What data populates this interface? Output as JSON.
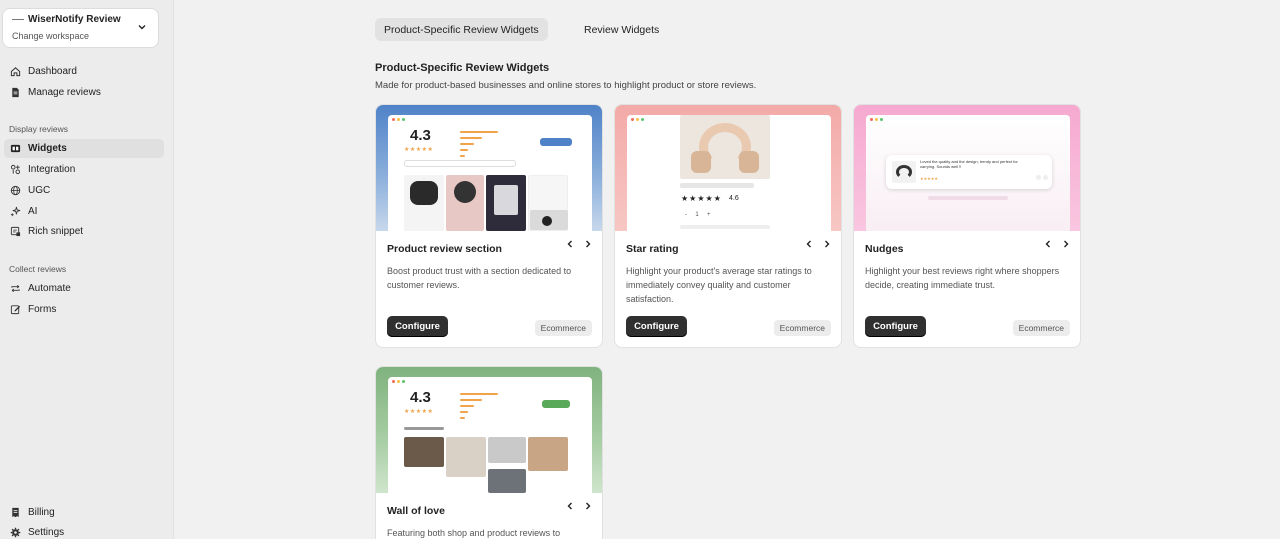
{
  "workspace": {
    "name": "WiserNotify Review",
    "sub": "Change workspace"
  },
  "nav": {
    "dashboard": "Dashboard",
    "manage_reviews": "Manage reviews",
    "display_group": "Display reviews",
    "widgets": "Widgets",
    "integration": "Integration",
    "ugc": "UGC",
    "ai": "AI",
    "rich_snippet": "Rich snippet",
    "collect_group": "Collect reviews",
    "automate": "Automate",
    "forms": "Forms",
    "billing": "Billing",
    "settings": "Settings"
  },
  "tabs": [
    "Product-Specific Review Widgets",
    "Review Widgets"
  ],
  "section": {
    "title": "Product-Specific Review Widgets",
    "desc": "Made for product-based businesses and online stores to highlight product or store reviews."
  },
  "cards": [
    {
      "title": "Product review section",
      "desc": "Boost product trust with a section dedicated to customer reviews.",
      "button": "Configure",
      "tag": "Ecommerce",
      "rating": "4.3"
    },
    {
      "title": "Star rating",
      "desc": "Highlight your product's average star ratings to immediately convey quality and customer satisfaction.",
      "button": "Configure",
      "tag": "Ecommerce",
      "rating": "4.6"
    },
    {
      "title": "Nudges",
      "desc": "Highlight your best reviews right where shoppers decide, creating immediate trust.",
      "button": "Configure",
      "tag": "Ecommerce",
      "quote": "Loved the quality and the design, trendy and perfect for carrying. Sounds well !!"
    },
    {
      "title": "Wall of love",
      "desc": "Featuring both shop and product reviews to",
      "rating": "4.3"
    }
  ],
  "colors": {
    "accent_dark": "#303030",
    "star": "#f0a34a"
  }
}
